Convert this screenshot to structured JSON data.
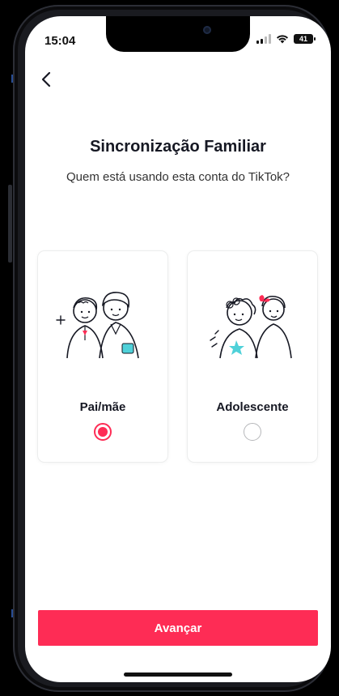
{
  "status_bar": {
    "time": "15:04",
    "battery_level": "41",
    "icons": [
      "signal-icon",
      "wifi-icon",
      "battery-icon"
    ]
  },
  "header": {
    "back_icon": "chevron-left-icon"
  },
  "page": {
    "title": "Sincronização Familiar",
    "subtitle": "Quem está usando esta conta do TikTok?"
  },
  "options": [
    {
      "label": "Pai/mãe",
      "selected": true,
      "illustration": "parents-illustration"
    },
    {
      "label": "Adolescente",
      "selected": false,
      "illustration": "teens-illustration"
    }
  ],
  "footer": {
    "next_label": "Avançar"
  },
  "colors": {
    "accent": "#fe2c55",
    "teal": "#4fd1d9",
    "text": "#161823"
  }
}
